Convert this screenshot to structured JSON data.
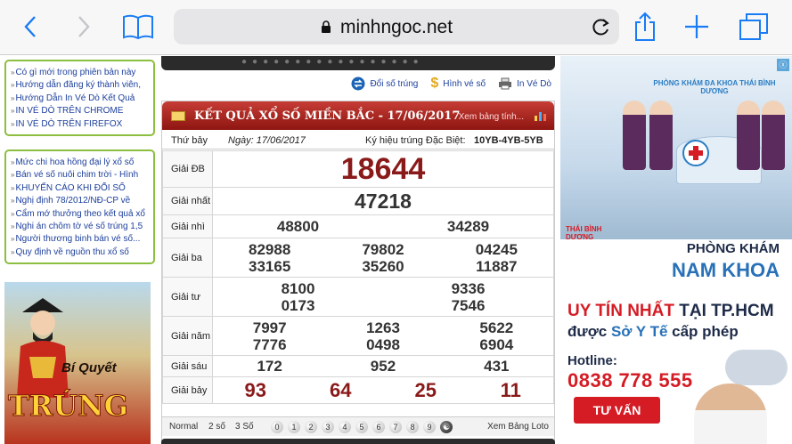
{
  "browser": {
    "url_host": "minhngoc.net"
  },
  "sidebar": {
    "box1": [
      "Có gì mới trong phiên bản này",
      "Hướng dẫn đăng ký thành viên,",
      "Hướng Dẫn In Vé Dò Kết Quả",
      "IN VÉ DÒ TRÊN CHROME",
      "IN VÉ DÒ TRÊN FIREFOX"
    ],
    "box2": [
      "Mức chi hoa hồng đại lý xổ số",
      "Bán vé số nuôi chim trời - Hình",
      "KHUYẾN CÁO KHI ĐỔI SỐ",
      "Nghị định 78/2012/NĐ-CP về",
      "Cẩm mớ thưởng theo kết quả xổ",
      "Nghi án chôm tờ vé số trúng 1,5",
      "Người thương binh bán vé số...",
      "Quy định về nguồn thu xổ số"
    ],
    "promo": {
      "line1": "Bí Quyết",
      "line2": "TRÚNG"
    }
  },
  "tools": {
    "doi_so": "Đổi số trúng",
    "hinh_ve": "Hình vé số",
    "in_ve": "In Vé Dò"
  },
  "results": {
    "title": "KẾT QUẢ XỔ SỐ MIỀN BẮC - 17/06/2017",
    "more": "Xem bảng tính...",
    "day": "Thứ bảy",
    "date": "Ngày: 17/06/2017",
    "special_code_label": "Ký hiệu trúng Đặc Biệt:",
    "special_code": "10YB-4YB-5YB",
    "prizes": [
      {
        "label": "Giải ĐB",
        "numbers": [
          "18644"
        ]
      },
      {
        "label": "Giải nhất",
        "numbers": [
          "47218"
        ]
      },
      {
        "label": "Giải nhì",
        "numbers": [
          "48800",
          "34289"
        ]
      },
      {
        "label": "Giải ba",
        "numbers": [
          "82988",
          "79802",
          "04245",
          "33165",
          "35260",
          "11887"
        ]
      },
      {
        "label": "Giải tư",
        "numbers": [
          "8100",
          "9336",
          "0173",
          "7546"
        ]
      },
      {
        "label": "Giải năm",
        "numbers": [
          "7997",
          "1263",
          "5622",
          "7776",
          "0498",
          "6904"
        ]
      },
      {
        "label": "Giải sáu",
        "numbers": [
          "172",
          "952",
          "431"
        ]
      },
      {
        "label": "Giải bảy",
        "numbers": [
          "93",
          "64",
          "25",
          "11"
        ]
      }
    ],
    "footer": {
      "normal": "Normal",
      "two": "2 số",
      "three": "3 Số",
      "balls": [
        "0",
        "1",
        "2",
        "3",
        "4",
        "5",
        "6",
        "7",
        "8",
        "9"
      ],
      "xem": "Xem Bảng Loto"
    }
  },
  "ad": {
    "sign": "PHÒNG KHÁM ĐA KHOA THÁI BÌNH DƯƠNG",
    "brand": "THÁI BÌNH DƯƠNG",
    "pk": "PHÒNG KHÁM",
    "nk": "NAM KHOA",
    "uytin_a": "UY TÍN NHẤT",
    "uytin_b": " TẠI TP.HCM",
    "duoc_a": "được ",
    "duoc_b": "Sở Y Tế",
    "duoc_c": " cấp phép",
    "hotline": "Hotline:",
    "phone": "0838 778 555",
    "cta": "TƯ VẤN",
    "close": "ⓧ"
  },
  "colors": {
    "accent": "#1a7cf5",
    "header_red": "#8e1511",
    "number_red": "#8a1a1a",
    "sidebar_border": "#8cbf3f"
  }
}
